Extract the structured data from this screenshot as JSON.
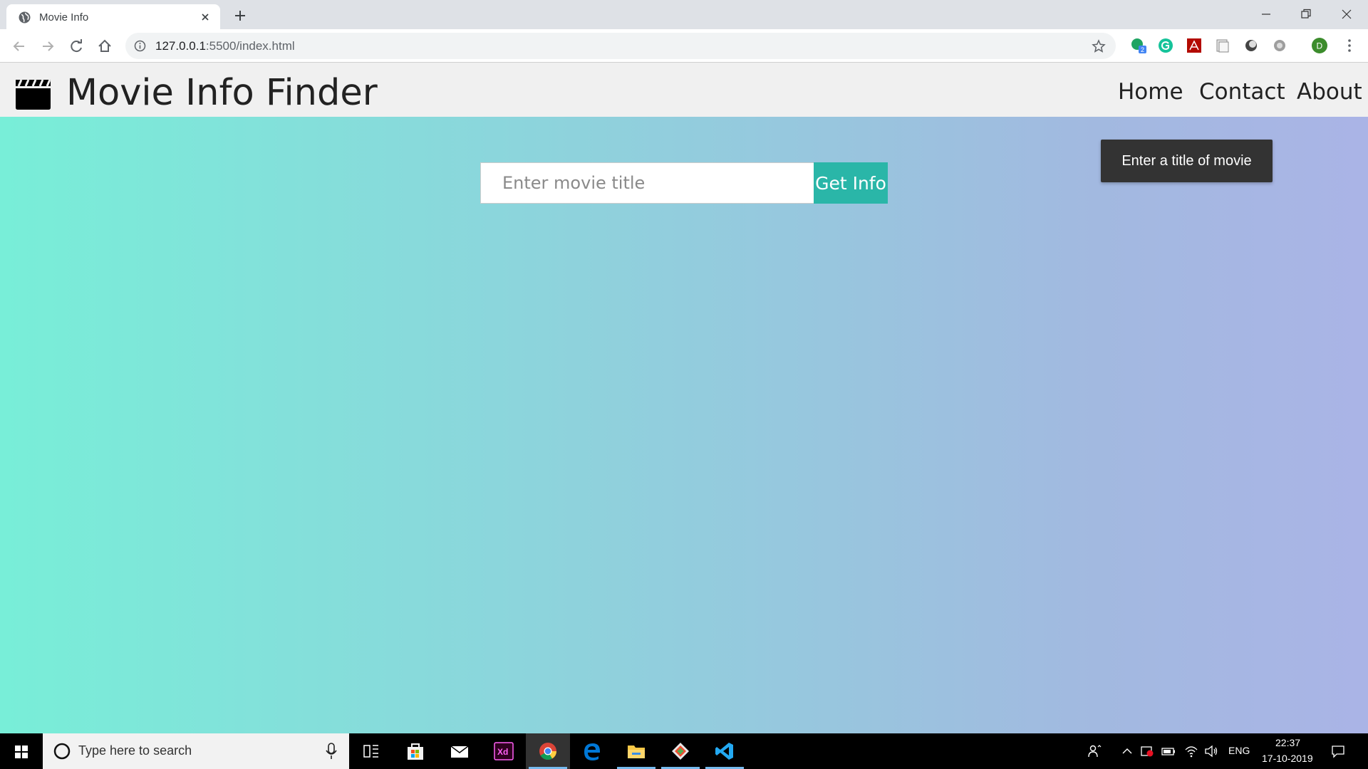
{
  "browser": {
    "tab_title": "Movie Info",
    "url_host": "127.0.0.1",
    "url_path": ":5500/index.html",
    "profile_initial": "D",
    "extension_badge": "2"
  },
  "site": {
    "title": "Movie Info Finder",
    "nav": [
      "Home",
      "Contact",
      "About"
    ],
    "search_placeholder": "Enter movie title",
    "search_value": "",
    "button_label": "Get Info",
    "toast": "Enter a title of movie",
    "gradient_start": "#78eed8",
    "gradient_end": "#aab4e6",
    "button_color": "#2ab6a8"
  },
  "taskbar": {
    "search_placeholder": "Type here to search",
    "language": "ENG",
    "time": "22:37",
    "date": "17-10-2019"
  }
}
